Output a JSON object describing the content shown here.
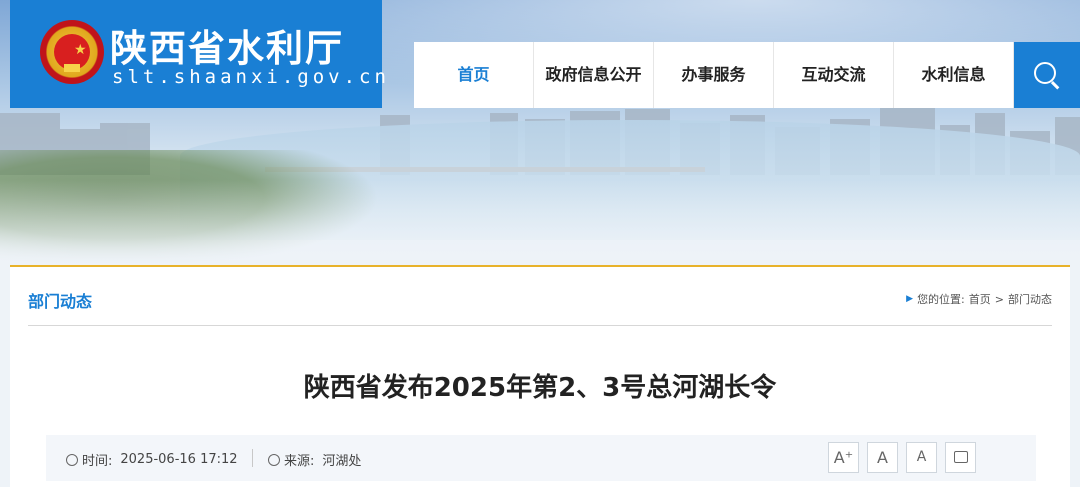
{
  "header": {
    "site_title": "陕西省水利厅",
    "site_domain": "slt.shaanxi.gov.cn"
  },
  "nav": {
    "items": [
      {
        "label": "首页",
        "active": true
      },
      {
        "label": "政府信息公开",
        "active": false
      },
      {
        "label": "办事服务",
        "active": false
      },
      {
        "label": "互动交流",
        "active": false
      },
      {
        "label": "水利信息",
        "active": false
      }
    ],
    "search_icon": "search-icon"
  },
  "section": {
    "title": "部门动态",
    "breadcrumb": {
      "prefix": "您的位置:",
      "home": "首页",
      "separator": ">",
      "current": "部门动态"
    }
  },
  "article": {
    "title": "陕西省发布2025年第2、3号总河湖长令",
    "time_label": "时间:",
    "time_value": "2025-06-16 17:12",
    "source_label": "来源:",
    "source_value": "河湖处"
  },
  "tools": {
    "font_large": "A⁺",
    "font_medium": "A",
    "font_small": "A",
    "print_icon": "print-icon"
  },
  "colors": {
    "brand_blue": "#1a7fd4",
    "accent_gold": "#e8b22a"
  }
}
